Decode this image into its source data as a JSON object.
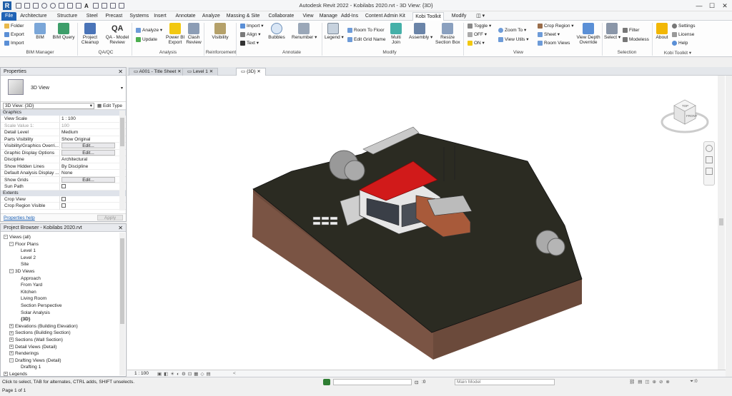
{
  "window": {
    "title": "Autodesk Revit 2022 - Kobilabs 2020.rvt - 3D View: {3D}"
  },
  "tabs": [
    "File",
    "Architecture",
    "Structure",
    "Steel",
    "Precast",
    "Systems",
    "Insert",
    "Annotate",
    "Analyze",
    "Massing & Site",
    "Collaborate",
    "View",
    "Manage",
    "Add-Ins",
    "Content Admin Kit",
    "Kobi Toolkit",
    "Modify"
  ],
  "active_tab": "Kobi Toolkit",
  "ribbon": {
    "bim_manager": {
      "title": "BIM Manager",
      "folder": "Folder",
      "export": "Export",
      "import": "Import",
      "bim": "BIM",
      "bim_query": "BIM Query"
    },
    "qa_qc": {
      "title": "QA/QC",
      "project_cleanup_1": "Project",
      "project_cleanup_2": "Cleanup",
      "qa_model_1": "QA - Model",
      "qa_model_2": "Review"
    },
    "analysis": {
      "title": "Analysis",
      "analyze": "Analyze",
      "update": "Update",
      "powerbi_1": "Power BI",
      "powerbi_2": "Export",
      "clash_1": "Clash",
      "clash_2": "Review"
    },
    "reinforcement": {
      "title": "Reinforcement",
      "visibility": "Visibility"
    },
    "annotate": {
      "title": "Annotate",
      "import": "Import",
      "align": "Align",
      "text": "Text",
      "bubbles": "Bubbles",
      "renumber": "Renumber"
    },
    "modify": {
      "title": "Modify",
      "legend": "Legend",
      "room_to_floor": "Room To Floor",
      "edit_grid_name": "Edit Grid Name",
      "multi_1": "Multi",
      "multi_2": "Join",
      "assembly": "Assembly",
      "resize_1": "Resize",
      "resize_2": "Section Box"
    },
    "view": {
      "title": "View",
      "toggle": "Toggle",
      "off": "OFF",
      "on": "ON",
      "zoom_to": "Zoom To",
      "view_utils": "View Utils",
      "crop_region": "Crop Region",
      "sheet": "Sheet",
      "room_views": "Room Views",
      "depth_1": "View Depth",
      "depth_2": "Override"
    },
    "selection": {
      "title": "Selection",
      "select": "Select",
      "filter": "Filter",
      "modeless": "Modeless"
    },
    "kobi": {
      "title": "Kobi Toolkit",
      "about": "About",
      "settings": "Settings",
      "license": "License",
      "help": "Help"
    }
  },
  "properties": {
    "header": "Properties",
    "type_label": "3D View",
    "instance_selector": "3D View: {3D}",
    "edit_type": "Edit Type",
    "groups": {
      "graphics": "Graphics",
      "extents": "Extents"
    },
    "rows": [
      {
        "k": "View Scale",
        "v": "1 : 100"
      },
      {
        "k": "Scale Value    1:",
        "v": "100",
        "grey": true
      },
      {
        "k": "Detail Level",
        "v": "Medium"
      },
      {
        "k": "Parts Visibility",
        "v": "Show Original"
      },
      {
        "k": "Visibility/Graphics Overri...",
        "v": "Edit...",
        "btn": true
      },
      {
        "k": "Graphic Display Options",
        "v": "Edit...",
        "btn": true
      },
      {
        "k": "Discipline",
        "v": "Architectural"
      },
      {
        "k": "Show Hidden Lines",
        "v": "By Discipline"
      },
      {
        "k": "Default Analysis Display ...",
        "v": "None"
      },
      {
        "k": "Show Grids",
        "v": "Edit...",
        "btn": true
      },
      {
        "k": "Sun Path",
        "v": "",
        "check": true
      }
    ],
    "ext_rows": [
      {
        "k": "Crop View",
        "v": "",
        "check": true
      },
      {
        "k": "Crop Region Visible",
        "v": "",
        "check": true
      }
    ],
    "help": "Properties help",
    "apply": "Apply"
  },
  "browser": {
    "header": "Project Browser - Kobilabs 2020.rvt",
    "items": [
      {
        "t": "Views (all)",
        "lvl": 0,
        "tog": "−"
      },
      {
        "t": "Floor Plans",
        "lvl": 1,
        "tog": "−"
      },
      {
        "t": "Level 1",
        "lvl": 3
      },
      {
        "t": "Level 2",
        "lvl": 3
      },
      {
        "t": "Site",
        "lvl": 3
      },
      {
        "t": "3D Views",
        "lvl": 1,
        "tog": "−"
      },
      {
        "t": "Approach",
        "lvl": 3
      },
      {
        "t": "From Yard",
        "lvl": 3
      },
      {
        "t": "Kitchen",
        "lvl": 3
      },
      {
        "t": "Living Room",
        "lvl": 3
      },
      {
        "t": "Section Perspective",
        "lvl": 3
      },
      {
        "t": "Solar Analysis",
        "lvl": 3
      },
      {
        "t": "{3D}",
        "lvl": 3,
        "bold": true
      },
      {
        "t": "Elevations (Building Elevation)",
        "lvl": 1,
        "tog": "+"
      },
      {
        "t": "Sections (Building Section)",
        "lvl": 1,
        "tog": "+"
      },
      {
        "t": "Sections (Wall Section)",
        "lvl": 1,
        "tog": "+"
      },
      {
        "t": "Detail Views (Detail)",
        "lvl": 1,
        "tog": "+"
      },
      {
        "t": "Renderings",
        "lvl": 1,
        "tog": "+"
      },
      {
        "t": "Drafting Views (Detail)",
        "lvl": 1,
        "tog": "−"
      },
      {
        "t": "Drafting 1",
        "lvl": 3
      },
      {
        "t": "Legends",
        "lvl": 0,
        "tog": "+"
      }
    ]
  },
  "view_tabs": [
    {
      "label": "A001 - Title Sheet",
      "active": false
    },
    {
      "label": "Level 1",
      "active": false
    },
    {
      "label": "{3D}",
      "active": true
    }
  ],
  "viewcube": {
    "top": "TOP",
    "front": "FRONT"
  },
  "view_control": {
    "scale": "1 : 100"
  },
  "status": {
    "hint": "Click to select, TAB for alternates, CTRL adds, SHIFT unselects.",
    "zero": ":0",
    "model": "Main Model",
    "page": "Page 1 of 1"
  },
  "colors": {
    "accent": "#1f62b5",
    "roof": "#d11a1a",
    "terrain_top": "#2b2b22",
    "terrain_side": "#6b4a3b"
  }
}
